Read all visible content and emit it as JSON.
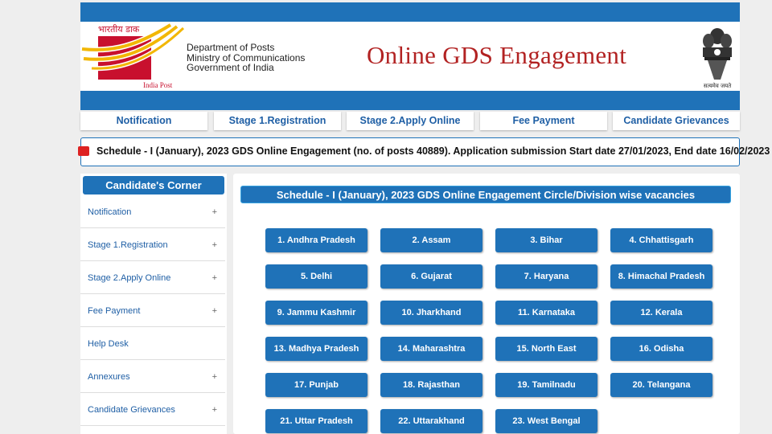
{
  "header": {
    "dept_lines": [
      "Department of Posts",
      "Ministry of Communications",
      "Government of India"
    ],
    "site_title": "Online GDS Engagement",
    "logo_script": "भारतीय डाक",
    "logo_caption": "India Post",
    "emblem_caption": "सत्यमेव जयते"
  },
  "nav": {
    "items": [
      "Notification",
      "Stage 1.Registration",
      "Stage 2.Apply Online",
      "Fee Payment",
      "Candidate Grievances"
    ]
  },
  "ticker": {
    "text": "Schedule - I (January), 2023 GDS Online Engagement (no. of posts 40889). Application submission Start date 27/01/2023, End date 16/02/2023"
  },
  "sidebar": {
    "title": "Candidate's Corner",
    "items": [
      {
        "label": "Notification",
        "expand": "+"
      },
      {
        "label": "Stage 1.Registration",
        "expand": "+"
      },
      {
        "label": "Stage 2.Apply Online",
        "expand": "+"
      },
      {
        "label": "Fee Payment",
        "expand": "+"
      },
      {
        "label": "Help Desk",
        "expand": ""
      },
      {
        "label": "Annexures",
        "expand": "+"
      },
      {
        "label": "Candidate Grievances",
        "expand": "+"
      }
    ]
  },
  "main": {
    "title": "Schedule - I (January), 2023 GDS Online Engagement Circle/Division wise vacancies",
    "circles": [
      "1. Andhra Pradesh",
      "2. Assam",
      "3. Bihar",
      "4. Chhattisgarh",
      "5. Delhi",
      "6. Gujarat",
      "7. Haryana",
      "8. Himachal Pradesh",
      "9. Jammu Kashmir",
      "10. Jharkhand",
      "11. Karnataka",
      "12. Kerala",
      "13. Madhya Pradesh",
      "14. Maharashtra",
      "15. North East",
      "16. Odisha",
      "17. Punjab",
      "18. Rajasthan",
      "19. Tamilnadu",
      "20. Telangana",
      "21. Uttar Pradesh",
      "22. Uttarakhand",
      "23. West Bengal"
    ]
  },
  "colors": {
    "brand_blue": "#1f72b8",
    "title_red": "#b22222",
    "logo_red": "#c8102e",
    "logo_yellow": "#f2b705"
  }
}
